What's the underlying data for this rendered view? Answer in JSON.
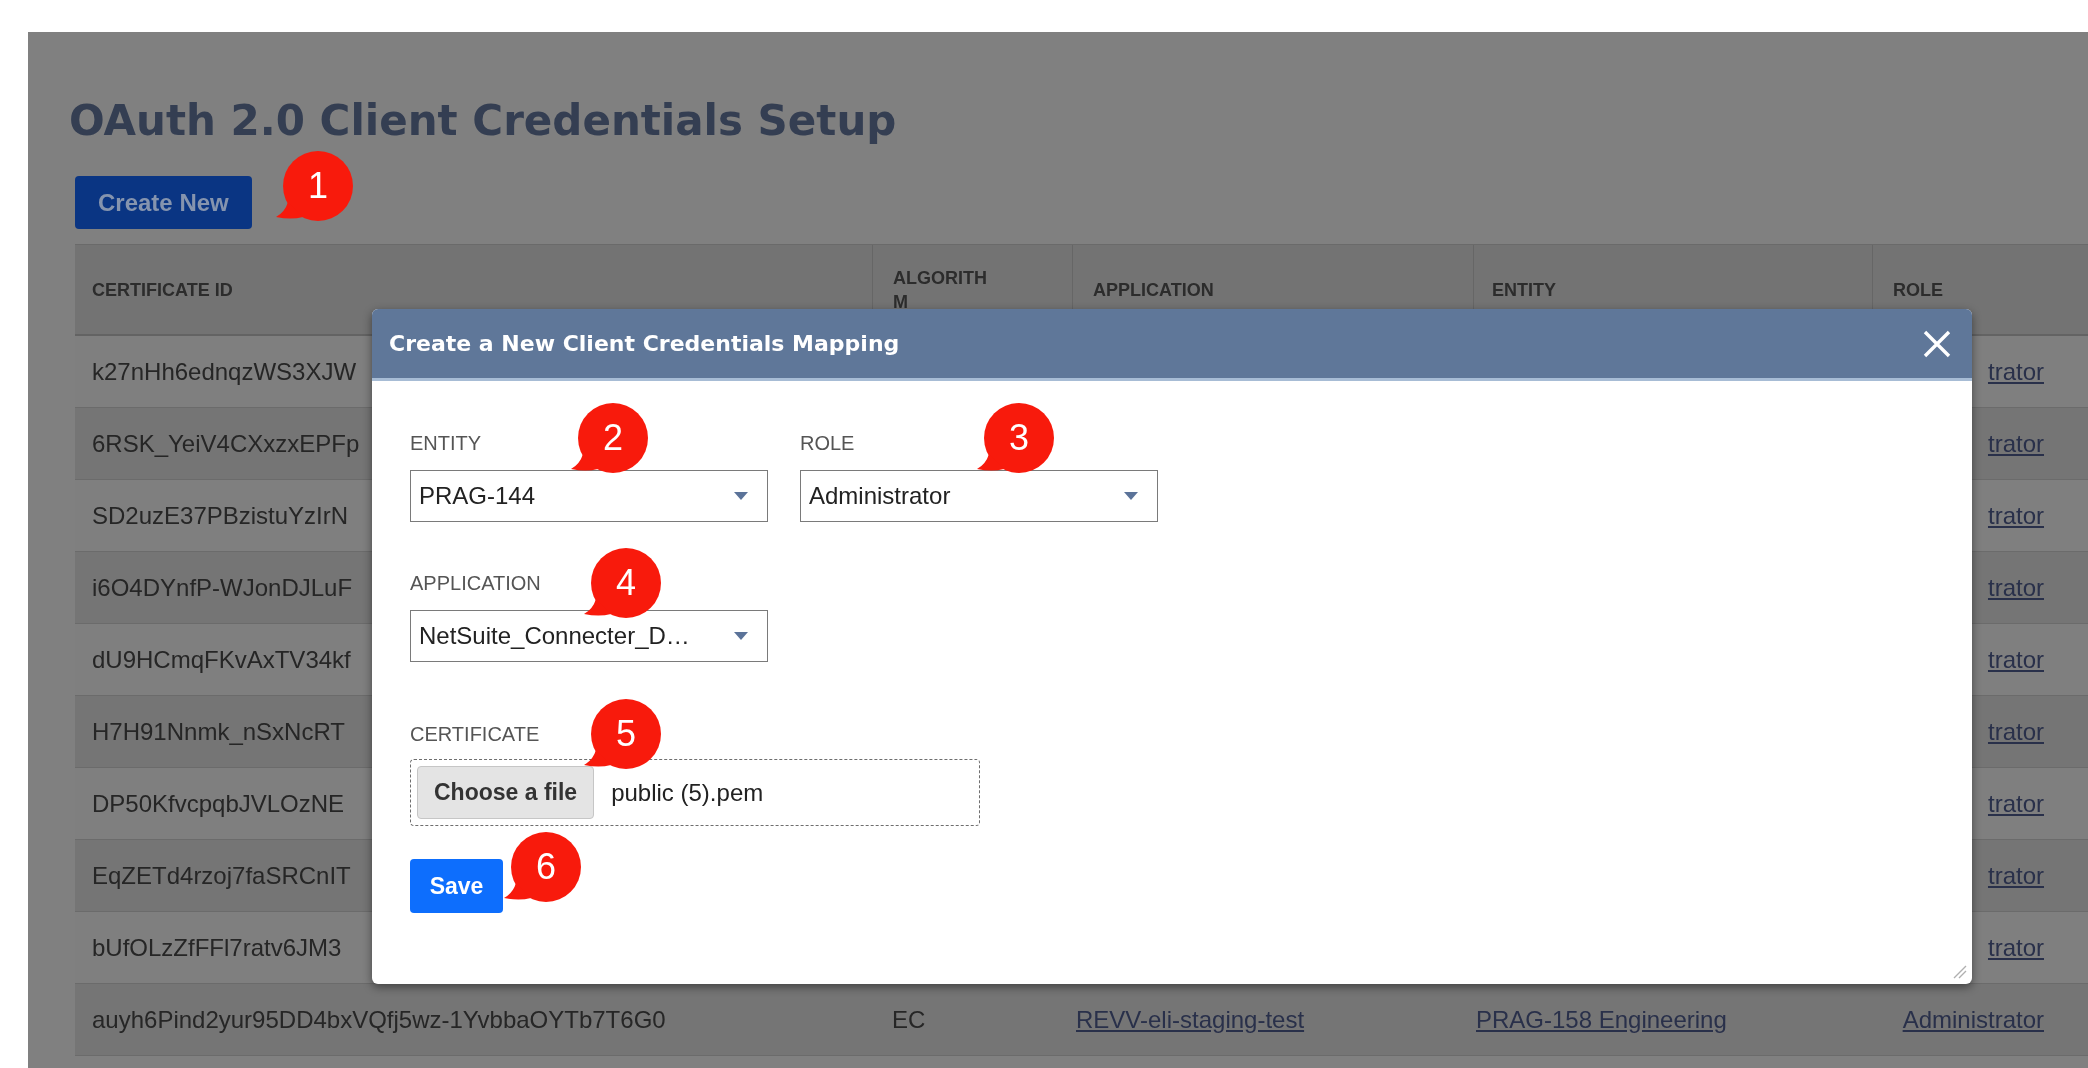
{
  "page": {
    "title": "OAuth 2.0 Client Credentials Setup",
    "create_button": "Create New"
  },
  "table": {
    "columns": [
      "CERTIFICATE ID",
      "ALGORITHM",
      "APPLICATION",
      "ENTITY",
      "ROLE"
    ],
    "rows": [
      {
        "certificate_id": "k27nHh6ednqzWS3XJW",
        "role": "trator"
      },
      {
        "certificate_id": "6RSK_YeiV4CXxzxEPFp",
        "role": "trator"
      },
      {
        "certificate_id": "SD2uzE37PBzistuYzIrN",
        "role": "trator"
      },
      {
        "certificate_id": "i6O4DYnfP-WJonDJLuF",
        "role": "trator"
      },
      {
        "certificate_id": "dU9HCmqFKvAxTV34kf",
        "role": "trator"
      },
      {
        "certificate_id": "H7H91Nnmk_nSxNcRT",
        "role": "trator"
      },
      {
        "certificate_id": "DP50KfvcpqbJVLOzNE",
        "role": "trator"
      },
      {
        "certificate_id": "EqZETd4rzoj7faSRCnIT",
        "role": "trator"
      },
      {
        "certificate_id": "bUfOLzZfFFl7ratv6JM3",
        "role": "trator"
      },
      {
        "certificate_id": "auyh6Pind2yur95DD4bxVQfj5wz-1YvbbaOYTb7T6G0",
        "algorithm": "EC",
        "application": "REVV-eli-staging-test",
        "entity": "PRAG-158 Engineering",
        "role": "Administrator"
      }
    ]
  },
  "dialog": {
    "title": "Create a New Client Credentials Mapping",
    "rows": [
      {
        "fields": [
          {
            "kind": "select",
            "label": "ENTITY",
            "value": "PRAG-144"
          },
          {
            "kind": "select",
            "label": "ROLE",
            "value": "Administrator"
          }
        ]
      },
      {
        "fields": [
          {
            "kind": "select",
            "label": "APPLICATION",
            "value": "NetSuite_Connecter_D…"
          }
        ]
      },
      {
        "fields": [
          {
            "kind": "file",
            "label": "CERTIFICATE",
            "button": "Choose a file",
            "value": "public (5).pem"
          }
        ]
      }
    ],
    "save_button": "Save"
  },
  "callouts": [
    "1",
    "2",
    "3",
    "4",
    "5",
    "6"
  ]
}
